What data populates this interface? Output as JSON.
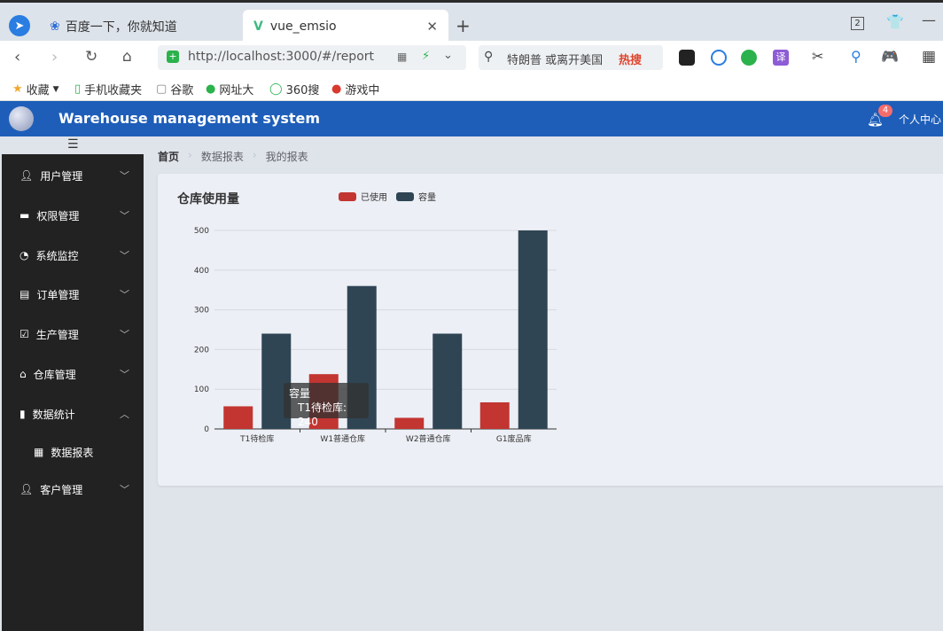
{
  "browser": {
    "tab1_label": "百度一下，你就知道",
    "tab2_label": "vue_emsio",
    "url": "http://localhost:3000/#/report",
    "search_text": "特朗普 或离开美国",
    "hot_label": "热搜",
    "tab_count": "2",
    "bookmarks": [
      "收藏",
      "手机收藏夹",
      "谷歌",
      "网址大",
      "360搜",
      "游戏中"
    ]
  },
  "header": {
    "title": "Warehouse management system",
    "notification_count": "4",
    "user_label": "个人中心"
  },
  "sidebar": {
    "items": [
      {
        "label": "用户管理",
        "icon": "user-icon",
        "chev": "﹀"
      },
      {
        "label": "权限管理",
        "icon": "monitor-icon",
        "chev": "﹀"
      },
      {
        "label": "系统监控",
        "icon": "gauge-icon",
        "chev": "﹀"
      },
      {
        "label": "订单管理",
        "icon": "document-icon",
        "chev": "﹀"
      },
      {
        "label": "生产管理",
        "icon": "checklist-icon",
        "chev": "﹀"
      },
      {
        "label": "仓库管理",
        "icon": "home-icon",
        "chev": "﹀"
      },
      {
        "label": "数据统计",
        "icon": "bar-chart-icon",
        "chev": "︿"
      },
      {
        "label": "数据报表",
        "icon": "grid-icon",
        "chev": ""
      },
      {
        "label": "客户管理",
        "icon": "user-icon",
        "chev": "﹀"
      }
    ]
  },
  "breadcrumb": [
    "首页",
    "数据报表",
    "我的报表"
  ],
  "chart_data": {
    "type": "bar",
    "title": "仓库使用量",
    "categories": [
      "T1待检库",
      "W1普通仓库",
      "W2普通仓库",
      "G1废品库"
    ],
    "series": [
      {
        "name": "已使用",
        "values": [
          57,
          138,
          28,
          67
        ],
        "color": "#c23531"
      },
      {
        "name": "容量",
        "values": [
          240,
          360,
          240,
          500
        ],
        "color": "#2f4554"
      }
    ],
    "ylim": [
      0,
      500
    ],
    "yticks": [
      0,
      100,
      200,
      300,
      400,
      500
    ],
    "grid": true,
    "legend_position": "top"
  },
  "tooltip": {
    "title": "容量",
    "text": "T1待检库: 240"
  }
}
